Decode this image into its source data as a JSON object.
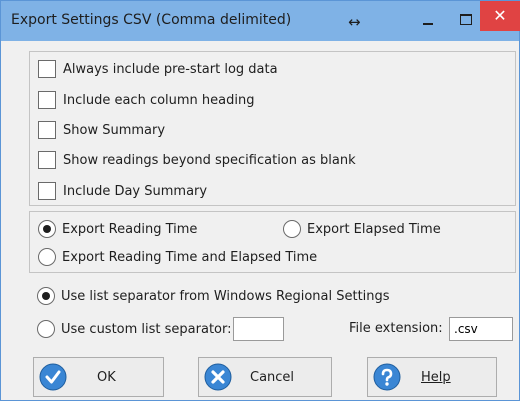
{
  "window": {
    "title": "Export Settings CSV (Comma delimited)",
    "resize_glyph": "↔",
    "close_glyph": "✕"
  },
  "checkboxes": [
    {
      "label": "Always include pre-start log data",
      "checked": false
    },
    {
      "label": "Include each column heading",
      "checked": false
    },
    {
      "label": "Show Summary",
      "checked": false
    },
    {
      "label": "Show readings beyond specification as blank",
      "checked": false
    },
    {
      "label": "Include Day Summary",
      "checked": false
    }
  ],
  "time_options": {
    "reading_time": "Export Reading Time",
    "elapsed_time": "Export Elapsed Time",
    "both": "Export Reading Time and Elapsed Time",
    "selected": "reading_time"
  },
  "separator_options": {
    "windows": "Use list separator from Windows Regional Settings",
    "custom": "Use custom list separator:",
    "selected": "windows",
    "custom_value": ""
  },
  "file_extension": {
    "label": "File extension:",
    "value": ".csv"
  },
  "buttons": {
    "ok": "OK",
    "cancel": "Cancel",
    "help": "Help"
  },
  "colors": {
    "titlebar": "#7fb2e6",
    "close": "#e04343",
    "button_icon": "#3a86d4"
  },
  "icons": {
    "ok": "check-icon",
    "cancel": "x-icon",
    "help": "question-icon"
  }
}
